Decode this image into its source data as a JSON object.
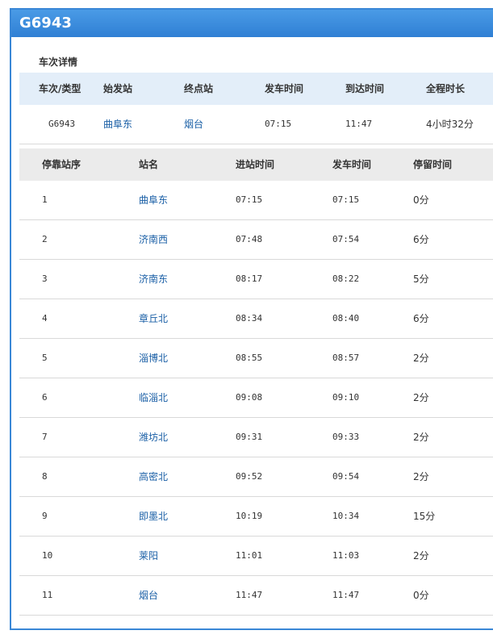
{
  "train_no": "G6943",
  "section_title": "车次详情",
  "summary": {
    "headers": [
      "车次/类型",
      "始发站",
      "终点站",
      "发车时间",
      "到达时间",
      "全程时长"
    ],
    "row": {
      "train_type": "G6943",
      "origin": "曲阜东",
      "destination": "烟台",
      "depart_time": "07:15",
      "arrive_time": "11:47",
      "duration": "4小时32分"
    }
  },
  "stops": {
    "headers": [
      "停靠站序",
      "站名",
      "进站时间",
      "发车时间",
      "停留时间"
    ],
    "rows": [
      {
        "seq": "1",
        "station": "曲阜东",
        "arrive": "07:15",
        "depart": "07:15",
        "stay": "0分"
      },
      {
        "seq": "2",
        "station": "济南西",
        "arrive": "07:48",
        "depart": "07:54",
        "stay": "6分"
      },
      {
        "seq": "3",
        "station": "济南东",
        "arrive": "08:17",
        "depart": "08:22",
        "stay": "5分"
      },
      {
        "seq": "4",
        "station": "章丘北",
        "arrive": "08:34",
        "depart": "08:40",
        "stay": "6分"
      },
      {
        "seq": "5",
        "station": "淄博北",
        "arrive": "08:55",
        "depart": "08:57",
        "stay": "2分"
      },
      {
        "seq": "6",
        "station": "临淄北",
        "arrive": "09:08",
        "depart": "09:10",
        "stay": "2分"
      },
      {
        "seq": "7",
        "station": "潍坊北",
        "arrive": "09:31",
        "depart": "09:33",
        "stay": "2分"
      },
      {
        "seq": "8",
        "station": "高密北",
        "arrive": "09:52",
        "depart": "09:54",
        "stay": "2分"
      },
      {
        "seq": "9",
        "station": "即墨北",
        "arrive": "10:19",
        "depart": "10:34",
        "stay": "15分"
      },
      {
        "seq": "10",
        "station": "莱阳",
        "arrive": "11:01",
        "depart": "11:03",
        "stay": "2分"
      },
      {
        "seq": "11",
        "station": "烟台",
        "arrive": "11:47",
        "depart": "11:47",
        "stay": "0分"
      }
    ]
  },
  "colors": {
    "header_blue": "#2f7fd4",
    "link_blue": "#1a5fa6",
    "summary_head_bg": "#e3eef9",
    "stops_head_bg": "#ebebeb"
  }
}
